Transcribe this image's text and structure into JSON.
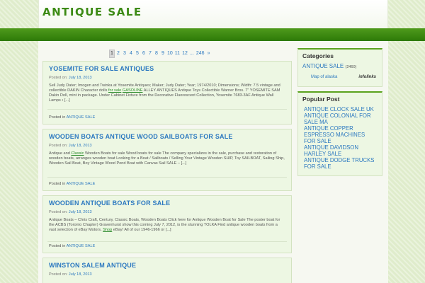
{
  "site": {
    "title": "ANTIQUE SALE"
  },
  "pagination": [
    "1",
    "2",
    "3",
    "4",
    "5",
    "6",
    "7",
    "8",
    "9",
    "10",
    "11",
    "12",
    "...",
    "246",
    "»"
  ],
  "posts": [
    {
      "title": "YOSEMITE FOR SALE ANTIQUES",
      "posted_on": "Posted on:",
      "date": "July 18, 2013",
      "body_a": "Sell Judy Dater; Imogen and Twinka at Yosemite Antiques; Maker; Judy Dater; Year; 1974/2010; Dimensions; Width: 7.5 vintage and collectible DAKIN Character dolls ",
      "body_link1": "for sale",
      "body_b": " ",
      "body_link2": "GASOLINE",
      "body_c": " ALLEY ANTIQUES Antique Toys Collectible Warner Bros. 7\" YOSEMITE SAM Dakin Doll, mint in package. Under Cabinet Fixture from the Decorative Fluorescent Collection, Yosemite 7683-3AF Antique Wall Lamps • [...]",
      "posted_in": "Posted in",
      "category": "ANTIQUE SALE"
    },
    {
      "title": "WOODEN BOATS ANTIQUE WOOD SAILBOATS FOR SALE",
      "posted_on": "Posted on:",
      "date": "July 18, 2013",
      "body_a": "Antique and ",
      "body_link1": "Classic",
      "body_b": " Wooden Boats for sale Wood boats for sale The company specializes in the sale, purchase and restoration of wooden boats, arranges wooden boat Looking for a Boat / Sailboats / Selling Your Vintage Wooden SHIP, Toy SAILBOAT, Sailing Ship, Wooden Sail Boat, Boy Vintage Wood Pond Boat with Canvas Sail SALE – [...]",
      "posted_in": "Posted in",
      "category": "ANTIQUE SALE"
    },
    {
      "title": "WOODEN ANTIQUE BOATS FOR SALE",
      "posted_on": "Posted on:",
      "date": "July 18, 2013",
      "body_a": "Antique Boats – Chris Craft, Century, Classic Boats, Wooden Boats Click here for Antique Wooden Boat for Sale The poster boat for the ACBS (Toronto Chapter) Gravenhurst show this coming July 7, 2012, is the stunning TOLKA Find antique wooden boats from a vast selection of eBay Motors. ",
      "body_link1": "Shop",
      "body_b": " eBay! All of our 1946-1966 or [...]",
      "posted_in": "Posted in",
      "category": "ANTIQUE SALE"
    },
    {
      "title": "WINSTON SALEM ANTIQUE",
      "posted_on": "Posted on:",
      "date": "July 18, 2013"
    }
  ],
  "sidebar": {
    "categories_title": "Categories",
    "category_name": "ANTIQUE SALE",
    "category_count": "(2460)",
    "ad_map": "Map of alaska",
    "ad_brand": "infolinks",
    "popular_title": "Popular Post",
    "popular": [
      "ANTIQUE CLOCK SALE UK",
      "ANTIQUE COLONIAL FOR SALE MA",
      "ANTIQUE COPPER ESPRESSO MACHINES FOR SALE",
      "ANTIQUE DAVIDSON HARLEY SALE",
      "ANTIQUE DODGE TRUCKS FOR SALE"
    ]
  },
  "colors": {
    "brand_green": "#3c8a14",
    "link_blue": "#2b78c0",
    "bar_green": "#3f8a12"
  }
}
